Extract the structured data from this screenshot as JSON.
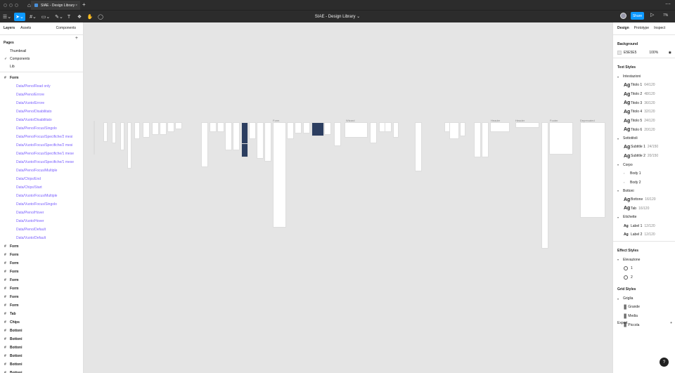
{
  "tab": {
    "title": "SIAE - Design Library"
  },
  "toolbar": {
    "file_title": "SIAE - Design Library ⌄",
    "share": "Share",
    "zoom": "7%"
  },
  "left": {
    "tabs": {
      "layers": "Layers",
      "assets": "Assets",
      "components": "Components"
    },
    "pages_title": "Pages",
    "pages": [
      "Thumbnail",
      "Components",
      "Lib"
    ],
    "layers": [
      {
        "name": "Form",
        "type": "frame",
        "bold": true
      },
      {
        "name": "Data/Pieno/Read only",
        "type": "comp"
      },
      {
        "name": "Data/Pieno/Errore",
        "type": "comp"
      },
      {
        "name": "Data/Vuoto/Errore",
        "type": "comp"
      },
      {
        "name": "Data/Pieno/Disabilitato",
        "type": "comp"
      },
      {
        "name": "Data/Vuoto/Disabilitato",
        "type": "comp"
      },
      {
        "name": "Data/Pieno/Focus/Singolo",
        "type": "comp"
      },
      {
        "name": "Data/Pieno/Focus/Specifiche/2 mesi",
        "type": "comp"
      },
      {
        "name": "Data/Vuoto/Focus/Specifiche/2 mesi",
        "type": "comp"
      },
      {
        "name": "Data/Pieno/Focus/Specifiche/1 mese",
        "type": "comp"
      },
      {
        "name": "Data/Vuoto/Focus/Specifiche/1 mese",
        "type": "comp"
      },
      {
        "name": "Data/Pieno/Focus/Multiple",
        "type": "comp"
      },
      {
        "name": "Data/Chips/End",
        "type": "comp"
      },
      {
        "name": "Data/Chips/Start",
        "type": "comp"
      },
      {
        "name": "Data/Vuoto/Focus/Multiple",
        "type": "comp"
      },
      {
        "name": "Data/Vuoto/Focus/Singolo",
        "type": "comp"
      },
      {
        "name": "Data/Pieno/Hover",
        "type": "comp"
      },
      {
        "name": "Data/Vuoto/Hover",
        "type": "comp"
      },
      {
        "name": "Data/Pieno/Default",
        "type": "comp"
      },
      {
        "name": "Data/Vuoto/Default",
        "type": "comp"
      },
      {
        "name": "Form",
        "type": "frame",
        "bold": true
      },
      {
        "name": "Form",
        "type": "frame",
        "bold": true
      },
      {
        "name": "Form",
        "type": "frame",
        "bold": true
      },
      {
        "name": "Form",
        "type": "frame",
        "bold": true
      },
      {
        "name": "Form",
        "type": "frame",
        "bold": true
      },
      {
        "name": "Form",
        "type": "frame",
        "bold": true
      },
      {
        "name": "Form",
        "type": "frame",
        "bold": true
      },
      {
        "name": "Form",
        "type": "frame",
        "bold": true
      },
      {
        "name": "Tab",
        "type": "frame",
        "bold": true
      },
      {
        "name": "Chips",
        "type": "frame",
        "bold": true
      },
      {
        "name": "Bottoni",
        "type": "frame",
        "bold": true
      },
      {
        "name": "Bottoni",
        "type": "frame",
        "bold": true
      },
      {
        "name": "Bottoni",
        "type": "frame",
        "bold": true
      },
      {
        "name": "Bottoni",
        "type": "frame",
        "bold": true
      },
      {
        "name": "Bottoni",
        "type": "frame",
        "bold": true
      },
      {
        "name": "Bottoni",
        "type": "frame",
        "bold": true
      }
    ]
  },
  "canvas": {
    "labels": [
      "Form",
      "Wizard",
      "Header",
      "Header",
      "Footer",
      "Deprecated"
    ]
  },
  "right": {
    "tabs": {
      "design": "Design",
      "prototype": "Prototype",
      "inspect": "Inspect"
    },
    "background": {
      "title": "Background",
      "hex": "E5E5E5",
      "opacity": "100%"
    },
    "text_styles_title": "Text Styles",
    "text_groups": [
      {
        "name": "Intestazioni",
        "items": [
          {
            "name": "Titolo 1",
            "meta": "64/120"
          },
          {
            "name": "Titolo 2",
            "meta": "48/120"
          },
          {
            "name": "Titolo 3",
            "meta": "36/120"
          },
          {
            "name": "Titolo 4",
            "meta": "32/120"
          },
          {
            "name": "Titolo 5",
            "meta": "24/120"
          },
          {
            "name": "Titolo 6",
            "meta": "20/120"
          }
        ]
      },
      {
        "name": "Sottotitoli",
        "items": [
          {
            "name": "Subtitle 1",
            "meta": "24/150"
          },
          {
            "name": "Subtitle 2",
            "meta": "20/150"
          }
        ]
      },
      {
        "name": "Corpo",
        "items": [
          {
            "name": "Body 1",
            "meta": "",
            "sub": true
          },
          {
            "name": "Body 2",
            "meta": "",
            "sub": true
          }
        ]
      },
      {
        "name": "Bottoni",
        "items": [
          {
            "name": "Bottone",
            "meta": "16/120"
          },
          {
            "name": "Tab",
            "meta": "16/120"
          }
        ]
      },
      {
        "name": "Etichette",
        "items": [
          {
            "name": "Label 1",
            "meta": "12/120",
            "small": true
          },
          {
            "name": "Label 2",
            "meta": "12/120",
            "small": true
          }
        ]
      }
    ],
    "effect_styles_title": "Effect Styles",
    "effect_group": "Elevazione",
    "effects": [
      "1",
      "2"
    ],
    "grid_styles_title": "Grid Styles",
    "grid_group": "Griglia",
    "grids": [
      "Grande",
      "Media",
      "Piccola"
    ],
    "export": "Export"
  }
}
